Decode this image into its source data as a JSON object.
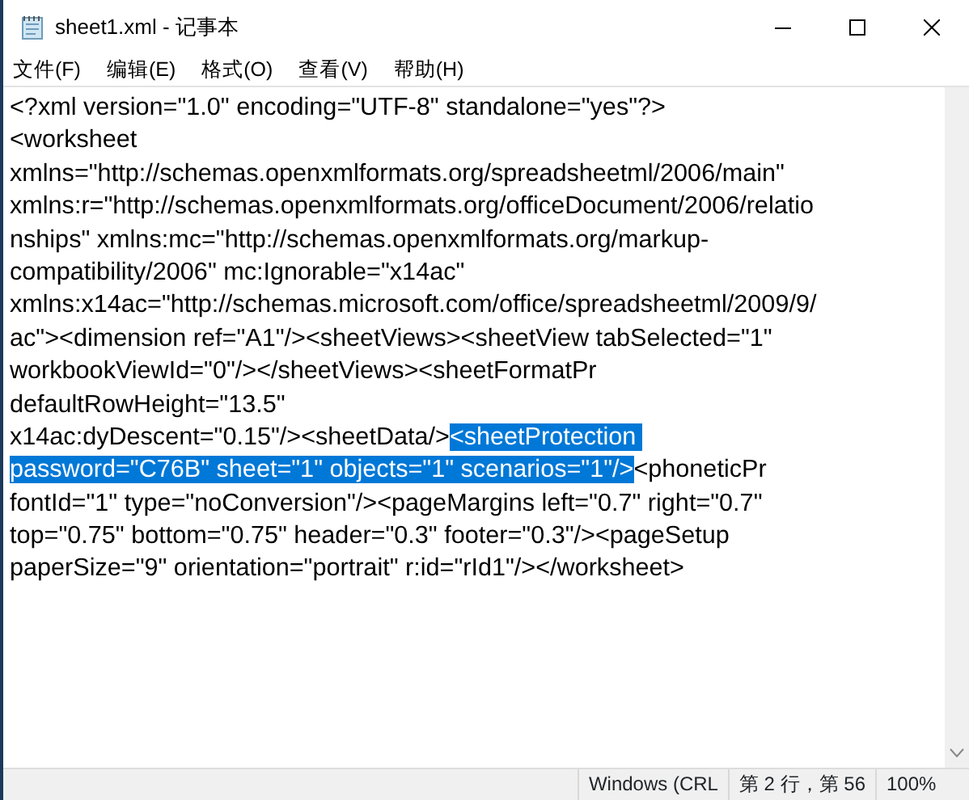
{
  "window": {
    "title": "sheet1.xml - 记事本"
  },
  "menu": [
    "文件(F)",
    "编辑(E)",
    "格式(O)",
    "查看(V)",
    "帮助(H)"
  ],
  "editor": {
    "lines": [
      [
        {
          "text": "<?xml version=\"1.0\" encoding=\"UTF-8\" standalone=\"yes\"?>",
          "selected": false
        }
      ],
      [
        {
          "text": "<worksheet",
          "selected": false
        }
      ],
      [
        {
          "text": "xmlns=\"http://schemas.openxmlformats.org/spreadsheetml/2006/main\"",
          "selected": false
        }
      ],
      [
        {
          "text": "xmlns:r=\"http://schemas.openxmlformats.org/officeDocument/2006/relatio",
          "selected": false
        }
      ],
      [
        {
          "text": "nships\" xmlns:mc=\"http://schemas.openxmlformats.org/markup-",
          "selected": false
        }
      ],
      [
        {
          "text": "compatibility/2006\" mc:Ignorable=\"x14ac\"",
          "selected": false
        }
      ],
      [
        {
          "text": "xmlns:x14ac=\"http://schemas.microsoft.com/office/spreadsheetml/2009/9/",
          "selected": false
        }
      ],
      [
        {
          "text": "ac\"><dimension ref=\"A1\"/><sheetViews><sheetView tabSelected=\"1\"",
          "selected": false
        }
      ],
      [
        {
          "text": "workbookViewId=\"0\"/></sheetViews><sheetFormatPr",
          "selected": false
        }
      ],
      [
        {
          "text": "defaultRowHeight=\"13.5\"",
          "selected": false
        }
      ],
      [
        {
          "text": "x14ac:dyDescent=\"0.15\"/><sheetData/>",
          "selected": false
        },
        {
          "text": "<sheetProtection ",
          "selected": true
        }
      ],
      [
        {
          "text": "password=\"C76B\" sheet=\"1\" objects=\"1\" scenarios=\"1\"/>",
          "selected": true
        },
        {
          "text": "<phoneticPr",
          "selected": false
        }
      ],
      [
        {
          "text": "fontId=\"1\" type=\"noConversion\"/><pageMargins left=\"0.7\" right=\"0.7\"",
          "selected": false
        }
      ],
      [
        {
          "text": "top=\"0.75\" bottom=\"0.75\" header=\"0.3\" footer=\"0.3\"/><pageSetup",
          "selected": false
        }
      ],
      [
        {
          "text": "paperSize=\"9\" orientation=\"portrait\" r:id=\"rId1\"/></worksheet>",
          "selected": false
        }
      ]
    ]
  },
  "status_bar": [
    "Windows (CRL",
    "第 2 行，第 56",
    "100%"
  ]
}
